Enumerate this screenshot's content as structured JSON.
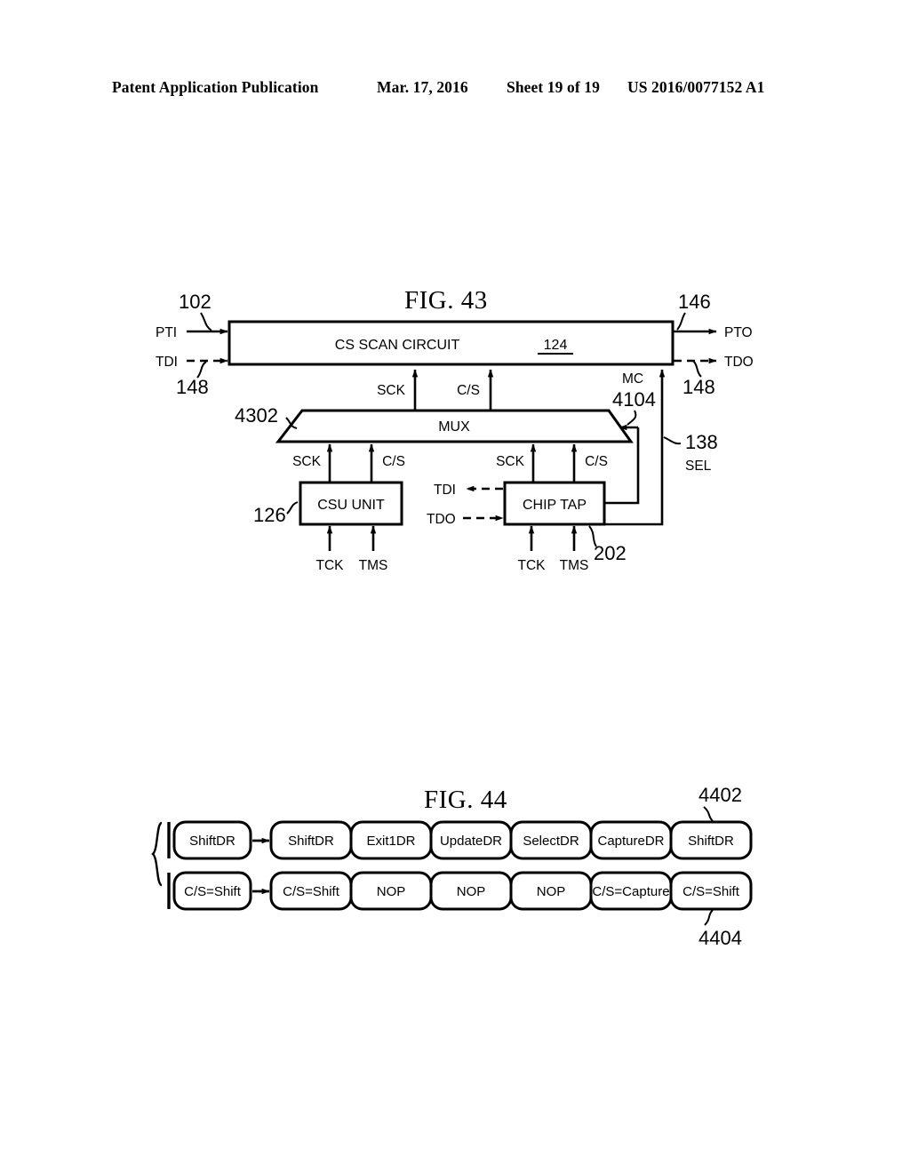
{
  "header": {
    "title": "Patent Application Publication",
    "date": "Mar. 17, 2016",
    "sheet": "Sheet 19 of 19",
    "publication_number": "US 2016/0077152 A1"
  },
  "fig43": {
    "title": "FIG. 43",
    "main_block": {
      "label": "CS SCAN CIRCUIT",
      "ref": "124"
    },
    "mux": {
      "label": "MUX",
      "ref": "4302"
    },
    "csu_unit": {
      "label": "CSU UNIT",
      "ref": "126"
    },
    "chip_tap": {
      "label": "CHIP TAP",
      "ref": "202"
    },
    "ports": {
      "pti": "PTI",
      "tdi_in": "TDI",
      "pto": "PTO",
      "tdo_out": "TDO",
      "tdi_tap": "TDI",
      "tdo_tap": "TDO"
    },
    "refs": {
      "pti_ref": "102",
      "pto_ref": "146",
      "tdi_ref": "148",
      "tdo_ref": "148",
      "mc_ref": "4104",
      "sel_ref": "138"
    },
    "signals": {
      "sck_upper": "SCK",
      "cs_upper": "C/S",
      "sck_csu": "SCK",
      "cs_csu": "C/S",
      "sck_tap": "SCK",
      "cs_tap": "C/S",
      "mc": "MC",
      "sel": "SEL",
      "tck_csu": "TCK",
      "tms_csu": "TMS",
      "tck_tap": "TCK",
      "tms_tap": "TMS"
    }
  },
  "fig44": {
    "title": "FIG. 44",
    "row1_ref": "4402",
    "row2_ref": "4404",
    "row1": [
      "ShiftDR",
      "ShiftDR",
      "Exit1DR",
      "UpdateDR",
      "SelectDR",
      "CaptureDR",
      "ShiftDR"
    ],
    "row2": [
      "C/S=Shift",
      "C/S=Shift",
      "NOP",
      "NOP",
      "NOP",
      "C/S=Capture",
      "C/S=Shift"
    ]
  }
}
